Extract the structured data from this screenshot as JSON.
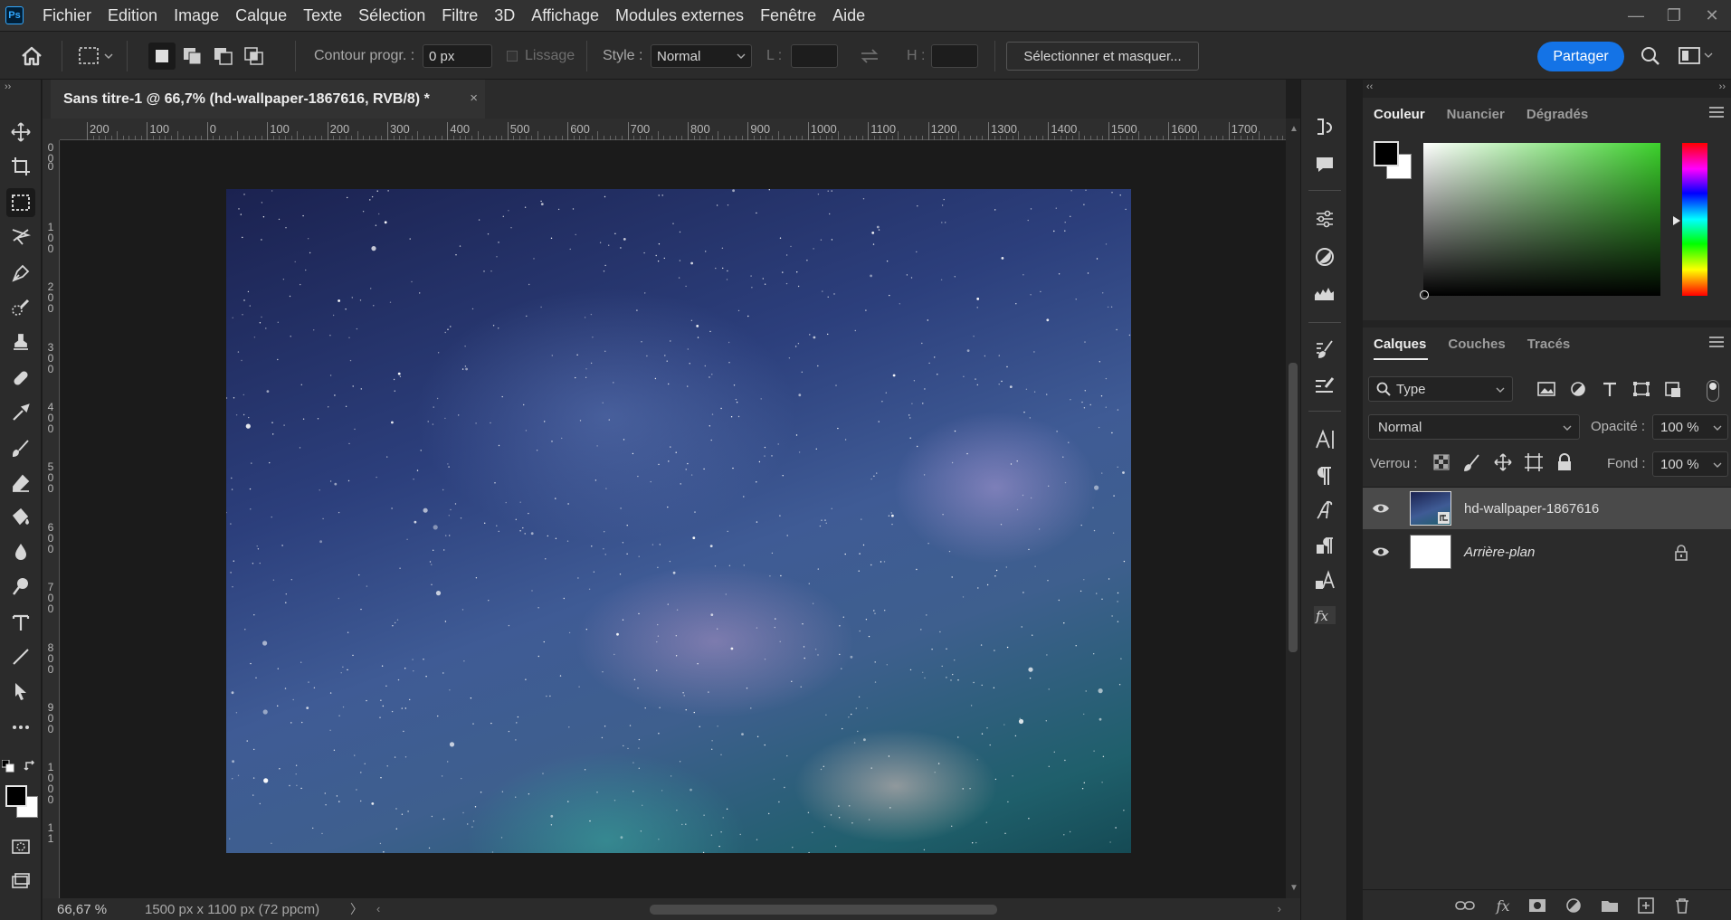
{
  "menubar": {
    "logo": "Ps",
    "items": [
      "Fichier",
      "Edition",
      "Image",
      "Calque",
      "Texte",
      "Sélection",
      "Filtre",
      "3D",
      "Affichage",
      "Modules externes",
      "Fenêtre",
      "Aide"
    ]
  },
  "options": {
    "feather_label": "Contour progr. :",
    "feather_value": "0 px",
    "antialias_label": "Lissage",
    "style_label": "Style :",
    "style_value": "Normal",
    "w_label": "L :",
    "h_label": "H :",
    "select_mask": "Sélectionner et masquer...",
    "share": "Partager"
  },
  "document": {
    "tab_title": "Sans titre-1 @ 66,7% (hd-wallpaper-1867616, RVB/8) *",
    "close": "×"
  },
  "ruler": {
    "h_ticks": [
      "200",
      "100",
      "0",
      "100",
      "200",
      "300",
      "400",
      "500",
      "600",
      "700",
      "800",
      "900",
      "1000",
      "1100",
      "1200",
      "1300",
      "1400",
      "1500",
      "1600",
      "1700"
    ],
    "v_ticks": [
      "0 0",
      "0",
      "1 0 0",
      "2 0 0",
      "3 0 0",
      "4 0 0",
      "5 0 0",
      "6 0 0",
      "7 0 0",
      "8 0 0",
      "9 0 0",
      "1 0 0 0",
      "1 1"
    ]
  },
  "status": {
    "zoom": "66,67 %",
    "info": "1500 px x 1100 px (72 ppcm)",
    "chevron": "〉"
  },
  "color_panel": {
    "tabs": [
      "Couleur",
      "Nuancier",
      "Dégradés"
    ],
    "fg": "#000000",
    "bg": "#ffffff",
    "hue": "#3bd12b"
  },
  "layers_panel": {
    "tabs": [
      "Calques",
      "Couches",
      "Tracés"
    ],
    "filter_label": "Type",
    "blend_mode": "Normal",
    "opacity_label": "Opacité :",
    "opacity_value": "100 %",
    "lock_label": "Verrou :",
    "fill_label": "Fond :",
    "fill_value": "100 %",
    "layers": [
      {
        "name": "hd-wallpaper-1867616",
        "selected": true,
        "italic": false
      },
      {
        "name": "Arrière-plan",
        "selected": false,
        "italic": true
      }
    ]
  },
  "colors": {
    "accent": "#1473e6",
    "panel": "#2b2b2b",
    "menubar": "#323232"
  }
}
